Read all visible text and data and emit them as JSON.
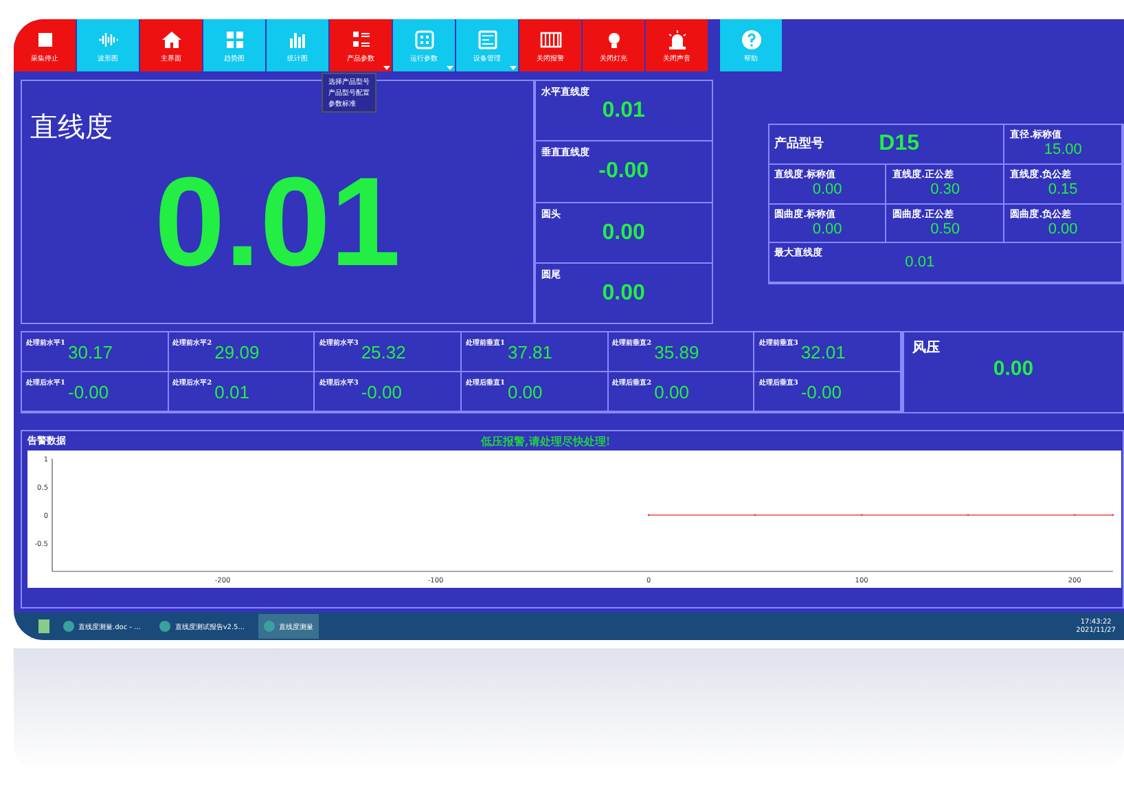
{
  "toolbar": [
    {
      "label": "采集停止",
      "kind": "stop",
      "color": "#ee1111",
      "dropdown": false
    },
    {
      "label": "波形图",
      "kind": "wave",
      "color": "#11c8ee",
      "dropdown": false
    },
    {
      "label": "主界面",
      "kind": "home",
      "color": "#ee1111",
      "dropdown": false
    },
    {
      "label": "趋势图",
      "kind": "grid",
      "color": "#11c8ee",
      "dropdown": false
    },
    {
      "label": "统计图",
      "kind": "bars",
      "color": "#11c8ee",
      "dropdown": false
    },
    {
      "label": "产品参数",
      "kind": "list",
      "color": "#ee1111",
      "dropdown": true
    },
    {
      "label": "运行参数",
      "kind": "panel",
      "color": "#11c8ee",
      "dropdown": true
    },
    {
      "label": "设备管理",
      "kind": "device",
      "color": "#11c8ee",
      "dropdown": true
    },
    {
      "label": "关闭报警",
      "kind": "keys",
      "color": "#ee1111",
      "dropdown": false
    },
    {
      "label": "关闭灯光",
      "kind": "bulb",
      "color": "#ee1111",
      "dropdown": false
    },
    {
      "label": "关闭声音",
      "kind": "siren",
      "color": "#ee1111",
      "dropdown": false
    },
    {
      "label": "帮助",
      "kind": "help",
      "color": "#11c8ee",
      "dropdown": false
    }
  ],
  "dropdown_menu": [
    "选择产品型号",
    "产品型号配置",
    "参数标准"
  ],
  "main": {
    "title": "直线度",
    "value": "0.01"
  },
  "readings": [
    {
      "label": "水平直线度",
      "value": "0.01"
    },
    {
      "label": "垂直直线度",
      "value": "-0.00"
    },
    {
      "label": "圆头",
      "value": "0.00"
    },
    {
      "label": "圆尾",
      "value": "0.00"
    }
  ],
  "product": {
    "model_label": "产品型号",
    "model": "D15",
    "diameter_label": "直径.标称值",
    "diameter": "15.00",
    "cells": [
      {
        "label": "直线度.标称值",
        "value": "0.00"
      },
      {
        "label": "直线度.正公差",
        "value": "0.30"
      },
      {
        "label": "直线度.负公差",
        "value": "0.15"
      },
      {
        "label": "圆曲度.标称值",
        "value": "0.00"
      },
      {
        "label": "圆曲度.正公差",
        "value": "0.50"
      },
      {
        "label": "圆曲度.负公差",
        "value": "0.00"
      }
    ],
    "max_label": "最大直线度",
    "max": "0.01"
  },
  "processing": [
    {
      "label": "处理前水平1",
      "value": "30.17"
    },
    {
      "label": "处理前水平2",
      "value": "29.09"
    },
    {
      "label": "处理前水平3",
      "value": "25.32"
    },
    {
      "label": "处理前垂直1",
      "value": "37.81"
    },
    {
      "label": "处理前垂直2",
      "value": "35.89"
    },
    {
      "label": "处理前垂直3",
      "value": "32.01"
    },
    {
      "label": "处理后水平1",
      "value": "-0.00"
    },
    {
      "label": "处理后水平2",
      "value": "0.01"
    },
    {
      "label": "处理后水平3",
      "value": "-0.00"
    },
    {
      "label": "处理后垂直1",
      "value": "0.00"
    },
    {
      "label": "处理后垂直2",
      "value": "0.00"
    },
    {
      "label": "处理后垂直3",
      "value": "-0.00"
    }
  ],
  "wind_pressure": {
    "label": "风压",
    "value": "0.00"
  },
  "alarm": {
    "title": "告警数据",
    "message": "低压报警,请处理尽快处理!",
    "chart_data": {
      "type": "line",
      "x": [
        0,
        50,
        100,
        150,
        200,
        218
      ],
      "series": [
        {
          "color": "#ee4444",
          "values": [
            0,
            0,
            0,
            0,
            0,
            0
          ]
        }
      ],
      "xlim": [
        -280,
        218
      ],
      "ylim": [
        -1,
        1
      ],
      "xticks": [
        -200,
        -100,
        0,
        100,
        200
      ],
      "yticks": [
        -0.5,
        0,
        0.5,
        1
      ]
    }
  },
  "taskbar": {
    "apps": [
      {
        "label": "直线度测量.doc - ...",
        "selected": false
      },
      {
        "label": "直线度测试报告v2.5...",
        "selected": false
      },
      {
        "label": "直线度测量",
        "selected": true
      }
    ],
    "time": "17:43:22",
    "date": "2021/11/27"
  }
}
